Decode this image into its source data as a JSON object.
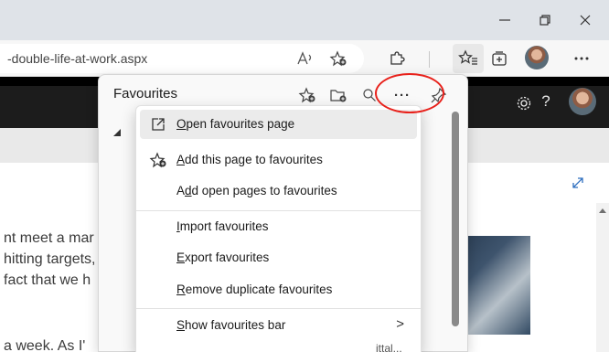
{
  "browser": {
    "address_text": "-double-life-at-work.aspx",
    "window_controls": {
      "minimize": "—",
      "close": "✕"
    }
  },
  "header_right": {
    "help_label": "?"
  },
  "page": {
    "lines": [
      "nt meet a mar",
      "hitting targets,",
      "fact that we h",
      "a week. As I'"
    ]
  },
  "favourites": {
    "title": "Favourites",
    "more_label": "···",
    "menu": [
      {
        "label": "Open favourites page",
        "icon": "open-new-window-icon",
        "highlighted": true
      },
      {
        "label": "Add this page to favourites",
        "icon": "star-add-icon",
        "highlighted": false
      },
      {
        "label": "Add open pages to favourites",
        "icon": "",
        "highlighted": false
      },
      {
        "label": "Import favourites",
        "icon": "",
        "highlighted": false
      },
      {
        "label": "Export favourites",
        "icon": "",
        "highlighted": false
      },
      {
        "label": "Remove duplicate favourites",
        "icon": "",
        "highlighted": false
      },
      {
        "label": "Show favourites bar",
        "icon": "",
        "highlighted": false,
        "chevron": ">"
      }
    ],
    "partial_trailing_text": "ittal..."
  },
  "colors": {
    "highlight_circle": "#e8211b",
    "site_header": "#1c1c1c",
    "accent_link": "#2f6fbf"
  }
}
